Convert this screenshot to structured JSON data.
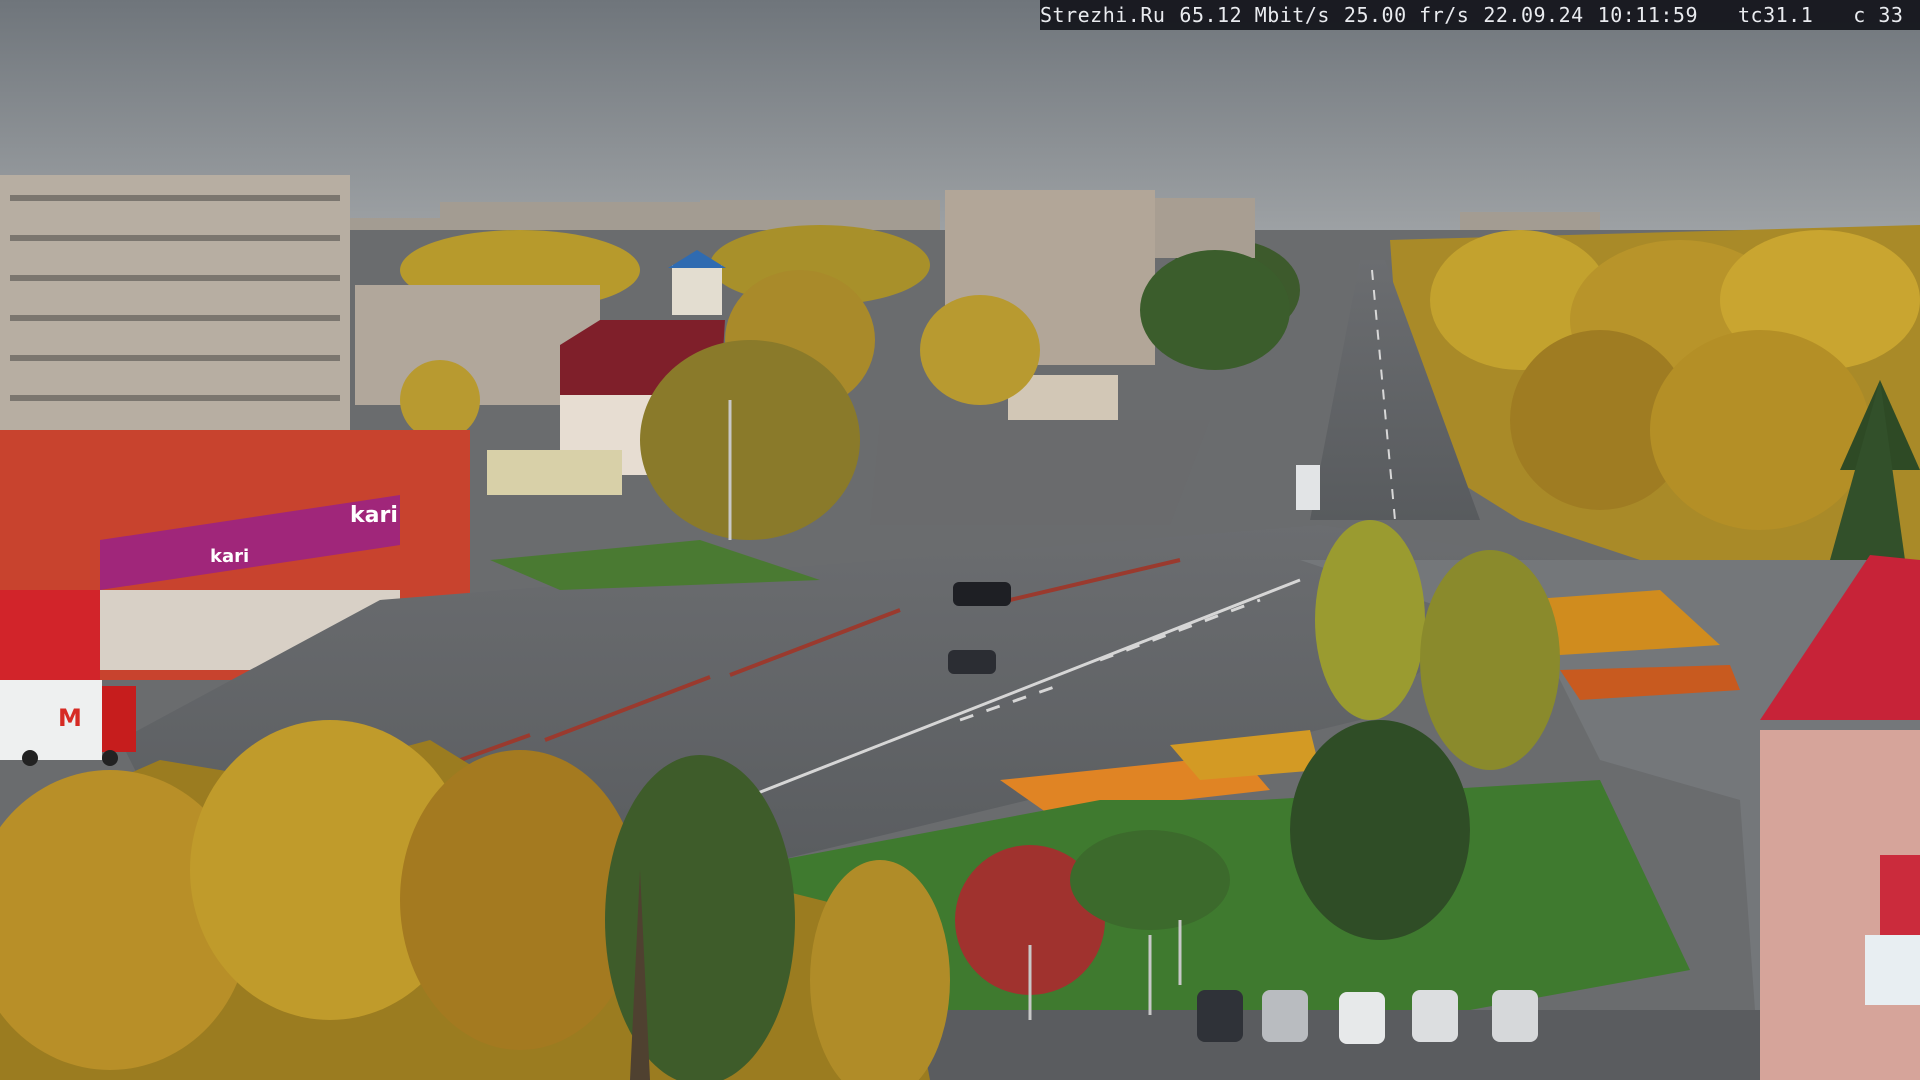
{
  "osd": {
    "site": "Strezhi.Ru",
    "bitrate": "65.12 Mbit/s",
    "fps": "25.00 fr/s",
    "date": "22.09.24",
    "time": "10:11:59",
    "camera": "tc31.1",
    "channel": "c 33"
  },
  "signs": {
    "store_logo": "kari",
    "store_tagline": "kari",
    "truck_logo": "M"
  },
  "colors": {
    "sky": "#7e8489",
    "road": "#5f6266",
    "grass": "#3f7a2f",
    "autumn_yellow": "#c9a227",
    "store_red": "#c8432e",
    "kari_purple": "#a0267a"
  }
}
